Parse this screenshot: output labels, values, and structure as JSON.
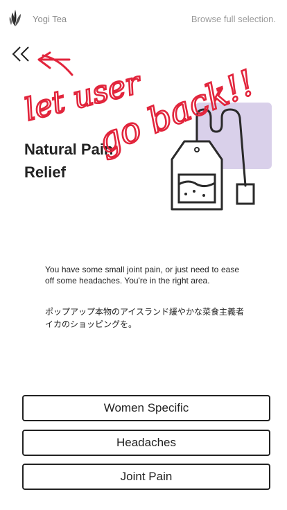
{
  "header": {
    "brand": "Yogi Tea",
    "browse_link": "Browse full selection."
  },
  "icons": {
    "logo": "leaf-logo-icon",
    "back": "double-chevron-left-icon",
    "illustration": "tea-bag-icon"
  },
  "colors": {
    "accent_lavender": "#d9d0ea",
    "annotation_red": "#e2253c",
    "text": "#222222",
    "muted": "#8a8a8a"
  },
  "main": {
    "title": "Natural Pain Relief",
    "description": "You have some small joint pain, or just need to ease off some headaches. You're in the right area.",
    "description_jp": "ポップアップ本物のアイスランド緩やかな菜食主義者イカのショッピングを。"
  },
  "options": [
    {
      "label": "Women Specific"
    },
    {
      "label": "Headaches"
    },
    {
      "label": "Joint Pain"
    }
  ],
  "annotation": {
    "line1": "let user",
    "line2": "go back!!"
  }
}
